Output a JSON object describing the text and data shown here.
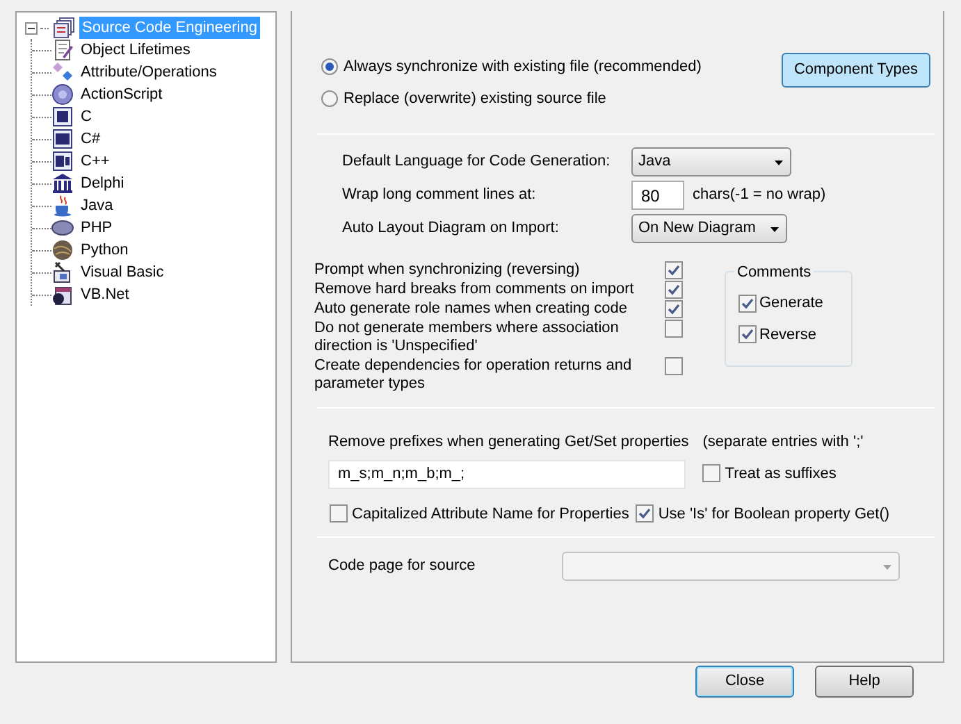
{
  "tree": {
    "label": "Source Code Engineering",
    "selected": true,
    "expanded": true,
    "children": [
      {
        "label": "Object Lifetimes",
        "selected": false
      },
      {
        "label": "Attribute/Operations",
        "selected": false
      },
      {
        "label": "ActionScript",
        "selected": false
      },
      {
        "label": "C",
        "selected": false
      },
      {
        "label": "C#",
        "selected": false
      },
      {
        "label": "C++",
        "selected": false
      },
      {
        "label": "Delphi",
        "selected": false
      },
      {
        "label": "Java",
        "selected": false
      },
      {
        "label": "PHP",
        "selected": false
      },
      {
        "label": "Python",
        "selected": false
      },
      {
        "label": "Visual Basic",
        "selected": false
      },
      {
        "label": "VB.Net",
        "selected": false
      }
    ]
  },
  "sync_options": [
    {
      "label": "Always synchronize with existing file (recommended)",
      "selected": true
    },
    {
      "label": "Replace (overwrite) existing source file",
      "selected": false
    }
  ],
  "component_types_button": "Component Types",
  "default_language": {
    "label": "Default Language for Code Generation:",
    "value": "Java"
  },
  "wrap": {
    "label": "Wrap long comment lines at:",
    "value": "80",
    "suffix": "chars(-1 = no wrap)"
  },
  "auto_layout": {
    "label": "Auto Layout Diagram on Import:",
    "value": "On New Diagram"
  },
  "options": [
    {
      "label": "Prompt when synchronizing (reversing)",
      "checked": true
    },
    {
      "label": "Remove hard breaks from  comments on import",
      "checked": true
    },
    {
      "label": "Auto generate role names when creating code",
      "checked": true
    },
    {
      "label": "Do not generate members where association direction is 'Unspecified'",
      "checked": false
    },
    {
      "label": "Create dependencies for operation returns and parameter types",
      "checked": false
    }
  ],
  "comments": {
    "title": "Comments",
    "options": [
      {
        "label": "Generate",
        "checked": true
      },
      {
        "label": "Reverse",
        "checked": true
      }
    ]
  },
  "prefixes": {
    "label": "Remove prefixes when generating Get/Set properties",
    "note": "(separate entries with ';'",
    "value": "m_s;m_n;m_b;m_;",
    "treat_as_suffixes": {
      "label": "Treat as suffixes",
      "checked": false
    }
  },
  "property_options": [
    {
      "label": "Capitalized Attribute Name for Properties",
      "checked": false
    },
    {
      "label": "Use 'Is' for Boolean property Get()",
      "checked": true
    }
  ],
  "code_page": {
    "label": "Code page for source",
    "disabled": true
  },
  "buttons": [
    {
      "label": "Close",
      "default": true
    },
    {
      "label": "Help",
      "default": false
    }
  ]
}
